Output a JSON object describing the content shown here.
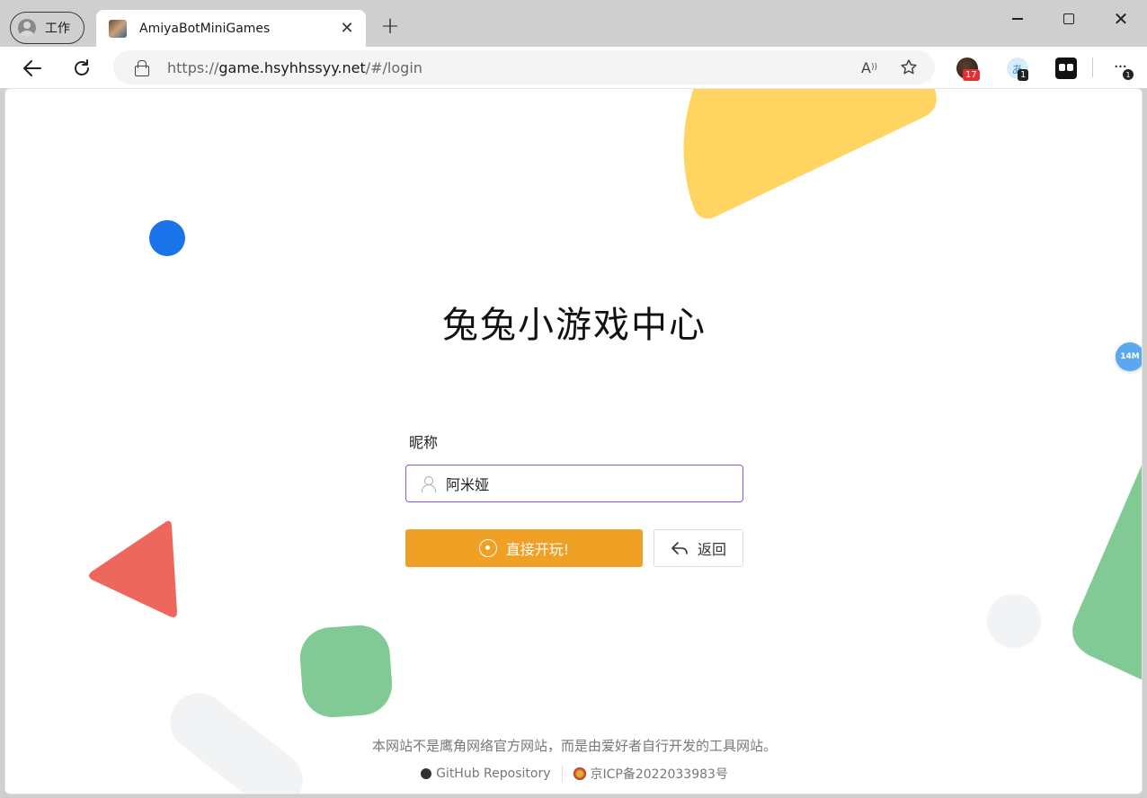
{
  "browser": {
    "profile_label": "工作",
    "tab_title": "AmiyaBotMiniGames",
    "tab_close": "✕",
    "new_tab": "+",
    "url_prefix": "https://",
    "url_host": "game.hsyhhssyy.net",
    "url_path": "/#/login",
    "extensions": [
      {
        "name": "ext-avatar",
        "badge": "17"
      },
      {
        "name": "ext-translate",
        "badge": "1"
      },
      {
        "name": "ext-tampermonkey",
        "badge": ""
      }
    ],
    "more_badge": "1",
    "float_badge": "14M"
  },
  "page": {
    "headline": "兔兔小游戏中心",
    "nickname_label": "昵称",
    "nickname_value": "阿米娅",
    "play_button": "直接开玩!",
    "back_button": "返回",
    "disclaimer": "本网站不是鹰角网络官方网站，而是由爱好者自行开发的工具网站。",
    "github_link": "GitHub Repository",
    "icp_link": "京ICP备2022033983号"
  },
  "colors": {
    "accent_orange": "#f0a024",
    "input_focus": "#8a55e0",
    "shape_yellow": "#ffd460",
    "shape_blue": "#1a73e8",
    "shape_red": "#ee675c",
    "shape_green": "#81c995",
    "shape_gray": "#f1f3f4"
  }
}
